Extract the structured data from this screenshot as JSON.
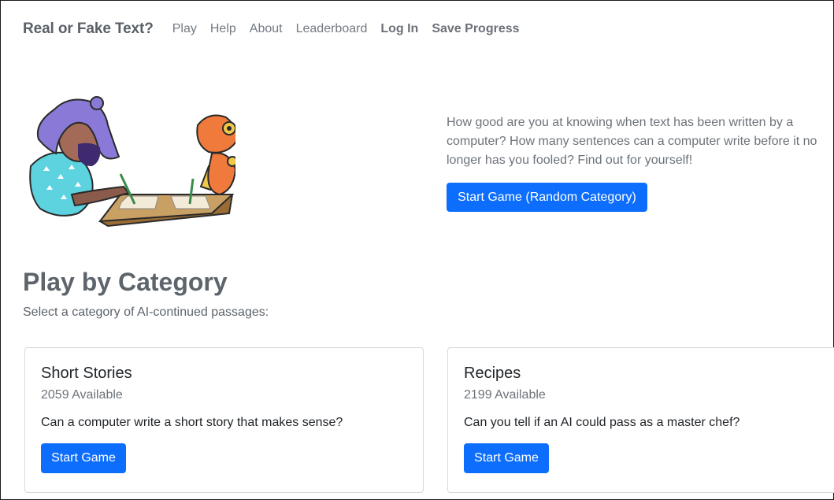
{
  "navbar": {
    "brand": "Real or Fake Text?",
    "links": [
      "Play",
      "Help",
      "About",
      "Leaderboard"
    ],
    "login": "Log In",
    "save": "Save Progress"
  },
  "hero": {
    "description": "How good are you at knowing when text has been written by a computer? How many sentences can a computer write before it no longer has you fooled? Find out for yourself!",
    "button": "Start Game (Random Category)"
  },
  "categories": {
    "title": "Play by Category",
    "subtitle": "Select a category of AI-continued passages:",
    "cards": [
      {
        "title": "Short Stories",
        "count": "2059 Available",
        "description": "Can a computer write a short story that makes sense?",
        "button": "Start Game"
      },
      {
        "title": "Recipes",
        "count": "2199 Available",
        "description": "Can you tell if an AI could pass as a master chef?",
        "button": "Start Game"
      }
    ]
  },
  "colors": {
    "primary": "#0d6efd",
    "hair": "#8a79d6",
    "robot": "#f07a3c",
    "desk": "#b98a4a"
  }
}
